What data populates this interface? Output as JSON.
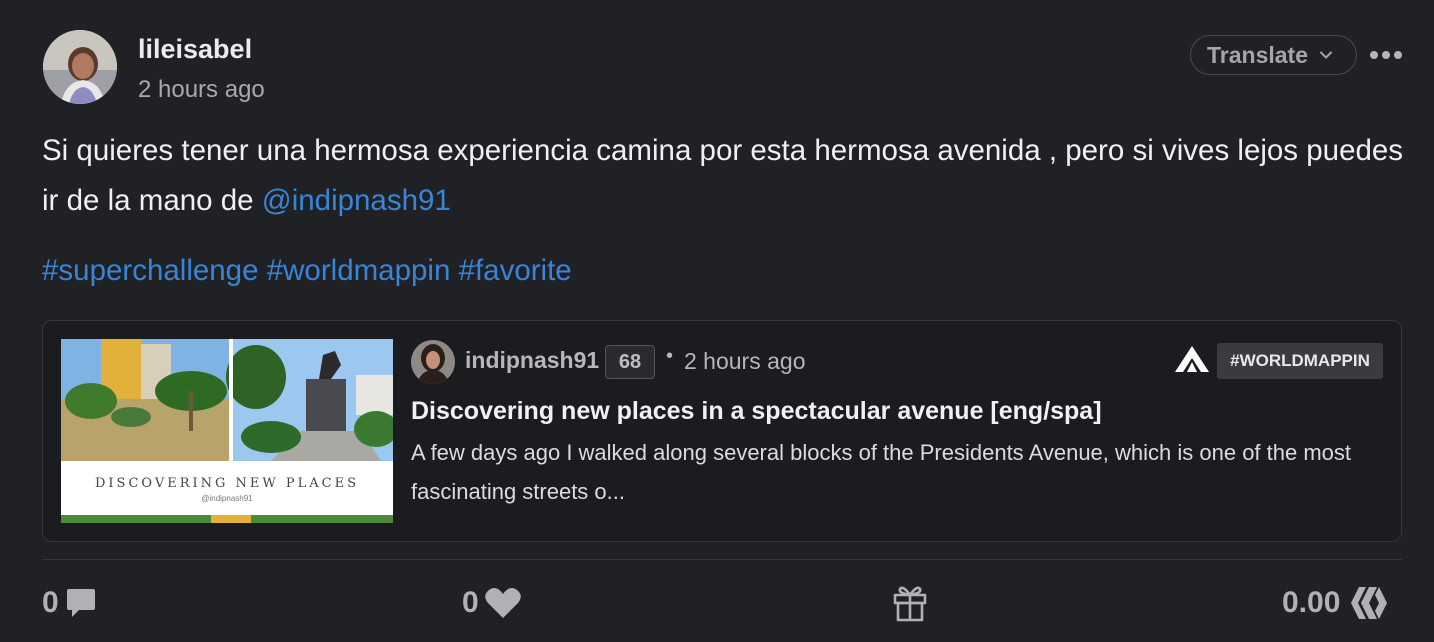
{
  "post": {
    "author": "lileisabel",
    "timestamp": "2 hours ago",
    "translate_label": "Translate",
    "text_main": "Si quieres tener una hermosa experiencia camina por esta hermosa avenida , pero si vives lejos puedes ir de la mano de ",
    "mention": "@indipnash91",
    "hashtags": [
      "#superchallenge",
      "#worldmappin",
      "#favorite"
    ]
  },
  "card": {
    "thumbnail_caption": "DISCOVERING NEW PLACES",
    "thumbnail_handle": "@indipnash91",
    "author": "indipnash91",
    "reputation": "68",
    "separator": "•",
    "timestamp": "2 hours ago",
    "community": "#WORLDMAPPIN",
    "title": "Discovering new places in a spectacular avenue [eng/spa]",
    "excerpt": "A few days ago I walked along several blocks of the Presidents Avenue, which is one of the most fascinating streets o..."
  },
  "footer": {
    "comments_count": "0",
    "votes_count": "0",
    "payout": "0.00"
  },
  "colors": {
    "background": "#202125",
    "link": "#3a84d6",
    "muted": "#a8a9ad"
  },
  "icons": [
    "chevron-down-icon",
    "more-options-icon",
    "comment-icon",
    "heart-icon",
    "gift-icon",
    "hive-icon",
    "community-logo-icon"
  ]
}
